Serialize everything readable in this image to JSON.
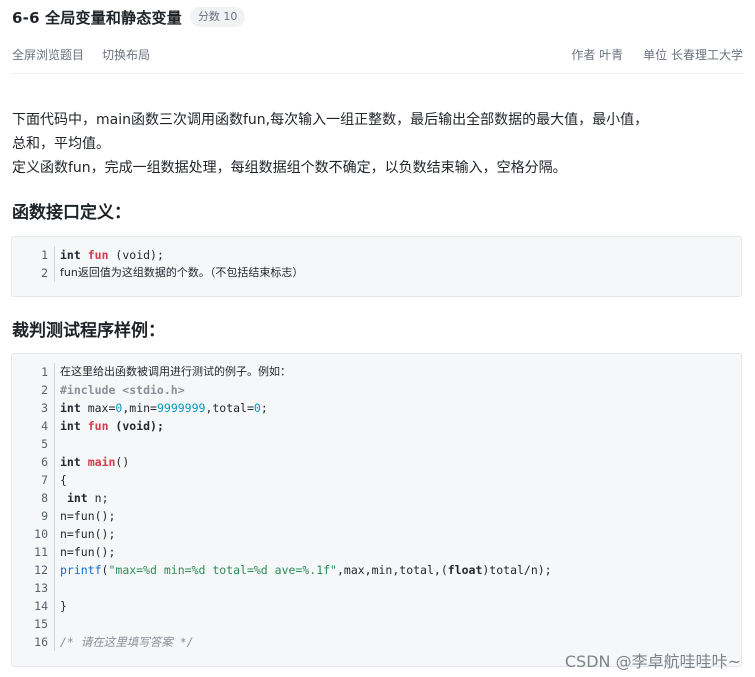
{
  "header": {
    "title": "6-6 全局变量和静态变量",
    "score": "分数 10"
  },
  "toolbar": {
    "fullscreen": "全屏浏览题目",
    "switch_layout": "切换布局",
    "author": "作者 叶青",
    "unit": "单位 长春理工大学"
  },
  "description": {
    "line1": "下面代码中，main函数三次调用函数fun,每次输入一组正整数，最后输出全部数据的最大值，最小值，",
    "line2": "总和，平均值。",
    "line3": "定义函数fun，完成一组数据处理，每组数据组个数不确定，以负数结束输入，空格分隔。"
  },
  "sections": {
    "interface_heading": "函数接口定义：",
    "test_heading": "裁判测试程序样例："
  },
  "interface_code": {
    "line_numbers": [
      "1",
      "2"
    ],
    "l1_int": "int",
    "l1_fun": "fun",
    "l1_rest": " (void);",
    "l2": "fun返回值为这组数据的个数。（不包括结束标志）"
  },
  "test_code": {
    "line_numbers": [
      "1",
      "2",
      "3",
      "4",
      "5",
      "6",
      "7",
      "8",
      "9",
      "10",
      "11",
      "12",
      "13",
      "14",
      "15",
      "16"
    ],
    "l1": "在这里给出函数被调用进行测试的例子。例如：",
    "l2": "#include <stdio.h>",
    "l3_int": "int",
    "l3_a": " max=",
    "l3_n1": "0",
    "l3_b": ",min=",
    "l3_n2": "9999999",
    "l3_c": ",total=",
    "l3_n3": "0",
    "l3_d": ";",
    "l4_int": "int",
    "l4_fun": "fun",
    "l4_rest": " (void);",
    "l6_int": "int",
    "l6_main": "main",
    "l6_rest": "()",
    "l7": "{",
    "l8_pre": " ",
    "l8_int": "int",
    "l8_rest": " n;",
    "l9": "n=fun();",
    "l10": "n=fun();",
    "l11": "n=fun();",
    "l12_call": "printf",
    "l12_a": "(",
    "l12_str": "\"max=%d min=%d total=%d ave=%.1f\"",
    "l12_b": ",max,min,total,(",
    "l12_float": "float",
    "l12_c": ")total/n);",
    "l14": "}",
    "l16": "/* 请在这里填写答案 */"
  },
  "watermark": "CSDN @李卓航哇哇咔~"
}
